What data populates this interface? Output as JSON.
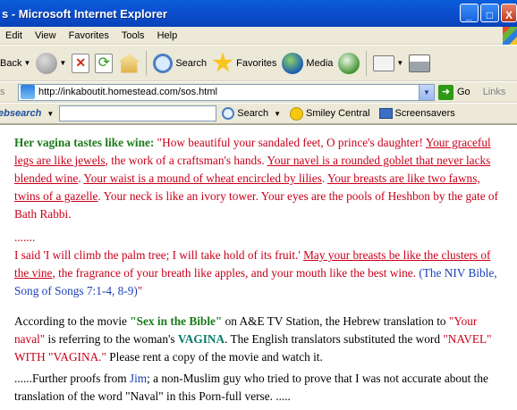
{
  "window": {
    "title": "s - Microsoft Internet Explorer",
    "controls": [
      "_",
      "□",
      "X"
    ]
  },
  "menu": [
    "Edit",
    "View",
    "Favorites",
    "Tools",
    "Help"
  ],
  "toolbar": {
    "back_label": "Back",
    "search_label": "Search",
    "favorites_label": "Favorites",
    "media_label": "Media"
  },
  "address": {
    "label": "s",
    "url": "http://inkaboutit.homestead.com/sos.html",
    "go_label": "Go",
    "links_label": "Links"
  },
  "websearch": {
    "brand": "ebsearch",
    "search_label": "Search",
    "smiley_label": "Smiley Central",
    "screensavers_label": "Screensavers"
  },
  "content": {
    "p1_heading": "Her vagina tastes like wine:",
    "p1_a": " \"How beautiful your sandaled feet, O prince's daughter! ",
    "p1_u1": "Your graceful legs are like jewels",
    "p1_b": ", the work of a craftsman's hands. ",
    "p1_u2": "Your navel is a rounded goblet that never lacks blended wine",
    "p1_c": ". ",
    "p1_u3": "Your waist is a mound of wheat encircled by lilies",
    "p1_d": ". ",
    "p1_u4": "Your breasts are like two fawns, twins of a gazelle",
    "p1_e": ". Your neck is like an ivory tower. Your eyes are the pools of Heshbon by the gate of Bath Rabbi.",
    "ellipsis": ".......",
    "p2_a": "I said 'I will climb the palm tree; I will take hold of its fruit.' ",
    "p2_u1": "May your breasts be like the clusters of the vine",
    "p2_b": ", the fragrance of your breath like apples, and your mouth like the best wine. ",
    "p2_ref": "(The NIV Bible, Song of Songs 7:1-4, 8-9)",
    "p2_end": "\"",
    "p3_a": "According to the movie ",
    "p3_movie": "\"Sex in the Bible\"",
    "p3_b": " on A&E TV Station, the Hebrew translation to ",
    "p3_naval": "\"Your naval\"",
    "p3_c": " is referring to the woman's ",
    "p3_vagina": "VAGINA",
    "p3_d": ". The English translators substituted the word ",
    "p3_navel": "\"NAVEL\" WITH \"VAGINA.\"",
    "p3_e": " Please rent a copy of the movie and watch it.",
    "p4_a": "......Further proofs from ",
    "p4_jim": "Jim",
    "p4_b": "; a non-Muslim guy who tried to prove that I was not accurate about the translation of the word \"Naval\" in this Porn-full verse. ....."
  }
}
